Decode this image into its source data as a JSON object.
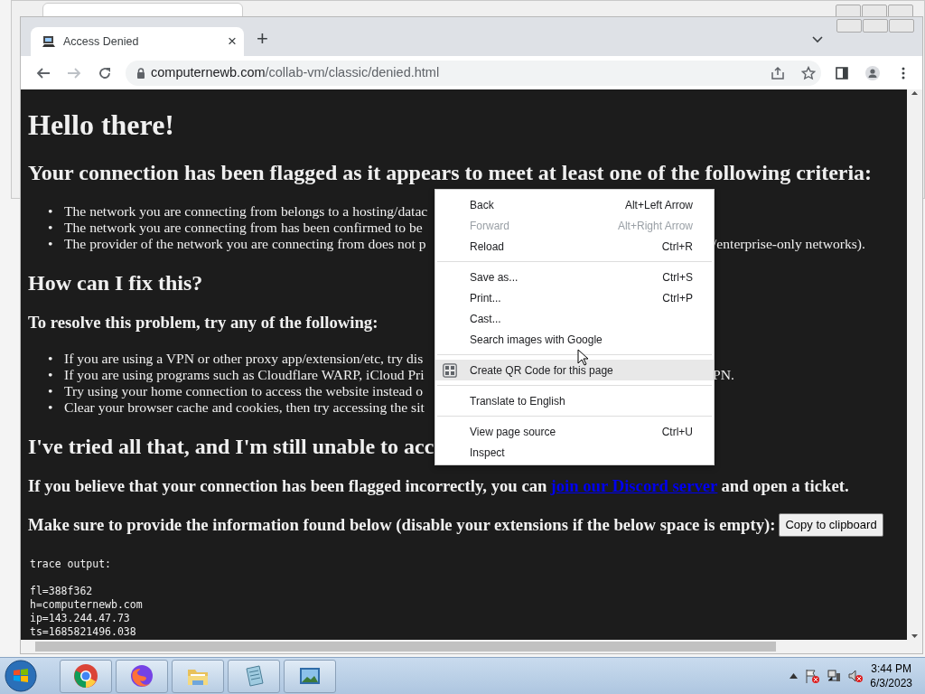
{
  "browser": {
    "tab": {
      "title": "Access Denied",
      "close": "×"
    },
    "new_tab": "+",
    "address": {
      "host": "computernewb.com",
      "path": "/collab-vm/classic/denied.html"
    },
    "forward_enabled": false
  },
  "page": {
    "title": "Hello there!",
    "blocks": [
      {
        "kind": "h2",
        "text": "Your connection has been flagged as it appears to meet at least one of the following criteria:"
      },
      {
        "kind": "list",
        "items": [
          {
            "bullet": "•",
            "text": "The network you are connecting from belongs to a hosting/datac"
          },
          {
            "bullet": "•",
            "text": "The network you are connecting from has been confirmed to be"
          },
          {
            "bullet": "•",
            "text": "The provider of the network you are connecting from does not p",
            "text_after": "/enterprise-only networks)."
          }
        ]
      },
      {
        "kind": "h2",
        "text": "How can I fix this?"
      },
      {
        "kind": "h3",
        "text": "To resolve this problem, try any of the following:"
      },
      {
        "kind": "list",
        "items": [
          {
            "bullet": "•",
            "text": "If you are using a VPN or other proxy app/extension/etc, try dis"
          },
          {
            "bullet": "•",
            "text": "If you are using programs such as Cloudflare WARP, iCloud Pri",
            "text_after": "PN."
          },
          {
            "bullet": "•",
            "text": "Try using your home connection to access the website instead o"
          },
          {
            "bullet": "•",
            "text": "Clear your browser cache and cookies, then try accessing the sit"
          }
        ]
      },
      {
        "kind": "h2",
        "text": "I've tried all that, and I'm still unable to acc"
      },
      {
        "kind": "link_para",
        "text": "If you believe that your connection has been flagged incorrectly, you can",
        "link": "join our Discord server",
        "text_after": "and open a ticket."
      },
      {
        "kind": "button_para",
        "text": "Make sure to provide the information found below (disable your extensions if the below space is empty):",
        "button": "Copy to clipboard"
      },
      {
        "kind": "pre",
        "heading": "trace output:",
        "lines": [
          "fl=388f362",
          "h=computernewb.com",
          "ip=143.244.47.73",
          "ts=1685821496.038"
        ]
      }
    ]
  },
  "context_menu": {
    "groups": [
      [
        {
          "label": "Back",
          "shortcut": "Alt+Left Arrow",
          "disabled": false,
          "highlighted": false
        },
        {
          "label": "Forward",
          "shortcut": "Alt+Right Arrow",
          "disabled": true,
          "highlighted": false
        },
        {
          "label": "Reload",
          "shortcut": "Ctrl+R",
          "disabled": false,
          "highlighted": false
        }
      ],
      [
        {
          "label": "Save as...",
          "shortcut": "Ctrl+S",
          "disabled": false,
          "highlighted": false
        },
        {
          "label": "Print...",
          "shortcut": "Ctrl+P",
          "disabled": false,
          "highlighted": false
        },
        {
          "label": "Cast...",
          "disabled": false,
          "highlighted": false
        },
        {
          "label": "Search images with Google",
          "disabled": false,
          "highlighted": false
        }
      ],
      [
        {
          "label": "Create QR Code for this page",
          "kind": "qr",
          "disabled": false,
          "highlighted": true
        }
      ],
      [
        {
          "label": "Translate to English",
          "disabled": false,
          "highlighted": false
        }
      ],
      [
        {
          "label": "View page source",
          "shortcut": "Ctrl+U",
          "disabled": false,
          "highlighted": false
        },
        {
          "label": "Inspect",
          "disabled": false,
          "highlighted": false
        }
      ]
    ]
  },
  "taskbar": {
    "apps": [
      {
        "kind": "chrome"
      },
      {
        "kind": "firefox"
      },
      {
        "kind": "explorer"
      },
      {
        "kind": "notepad"
      },
      {
        "kind": "photos"
      }
    ],
    "time": "3:44 PM",
    "date": "6/3/2023"
  }
}
